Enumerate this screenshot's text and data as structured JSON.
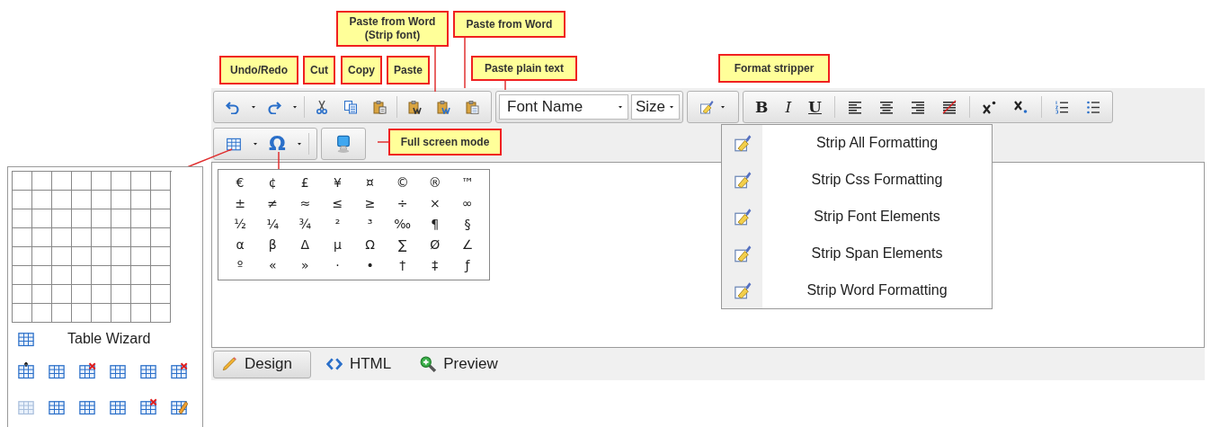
{
  "callouts": [
    {
      "text": "Paste from Word\n(Strip font)"
    },
    {
      "text": "Paste from Word"
    },
    {
      "text": "Undo/Redo"
    },
    {
      "text": "Cut"
    },
    {
      "text": "Copy"
    },
    {
      "text": "Paste"
    },
    {
      "text": "Paste plain text"
    },
    {
      "text": "Format stripper"
    },
    {
      "text": "Full screen mode"
    }
  ],
  "toolbar": {
    "font_name": "Font Name",
    "font_size": "Size",
    "bold": "B",
    "italic": "I",
    "underline": "U",
    "special_char": "Ω"
  },
  "table_menu": {
    "wizard": "Table Wizard"
  },
  "symbols": [
    [
      "€",
      "¢",
      "£",
      "¥",
      "¤",
      "©",
      "®",
      "™"
    ],
    [
      "±",
      "≠",
      "≈",
      "≤",
      "≥",
      "÷",
      "×",
      "∞"
    ],
    [
      "½",
      "¼",
      "¾",
      "²",
      "³",
      "‰",
      "¶",
      "§"
    ],
    [
      "α",
      "β",
      "Δ",
      "μ",
      "Ω",
      "∑",
      "Ø",
      "∠"
    ],
    [
      "º",
      "«",
      "»",
      "·",
      "•",
      "†",
      "‡",
      "ƒ"
    ]
  ],
  "format_menu": [
    {
      "label": "Strip All Formatting"
    },
    {
      "label": "Strip Css Formatting"
    },
    {
      "label": "Strip Font Elements"
    },
    {
      "label": "Strip Span Elements"
    },
    {
      "label": "Strip Word Formatting"
    }
  ],
  "view_tabs": [
    {
      "label": "Design",
      "selected": true
    },
    {
      "label": "HTML",
      "selected": false
    },
    {
      "label": "Preview",
      "selected": false
    }
  ]
}
